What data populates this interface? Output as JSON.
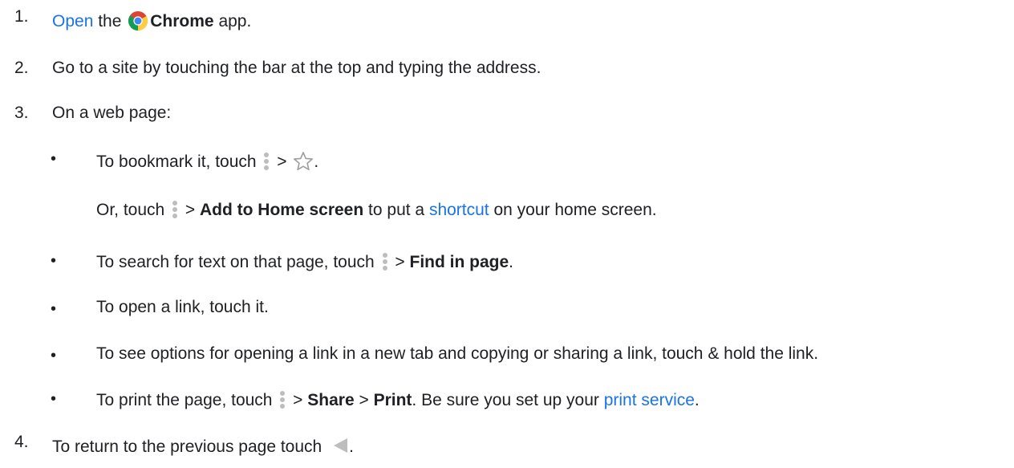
{
  "colors": {
    "link": "#1a73e8",
    "text": "#202124",
    "icon_gray": "#bdbdbd"
  },
  "steps": [
    {
      "number": "1.",
      "parts": {
        "open_link": "Open",
        "the": " the ",
        "app_name": "Chrome",
        "app": " app."
      },
      "icon": "chrome-icon"
    },
    {
      "number": "2.",
      "text": "Go to a site by touching the bar at the top and typing the address."
    },
    {
      "number": "3.",
      "text": "On a web page:",
      "bullets": [
        {
          "bullet": "•",
          "text_before": "To bookmark it, touch ",
          "sep": " > ",
          "end": ".",
          "icons": [
            "more-vert-icon",
            "star-icon"
          ],
          "sub": {
            "text_before": "Or, touch ",
            "sep": " > ",
            "bold": "Add to Home screen",
            "middle": " to put a ",
            "link": "shortcut",
            "end": " on your home screen."
          }
        },
        {
          "bullet": "•",
          "text_before": "To search for text on that page, touch ",
          "sep": " > ",
          "bold": "Find in page",
          "end": "."
        },
        {
          "bullet": "•",
          "text": "To open a link, touch it."
        },
        {
          "bullet": "•",
          "text": "To see options for opening a link in a new tab and copying or sharing a link, touch & hold the link."
        },
        {
          "bullet": "•",
          "text_before": "To print the page, touch ",
          "sep1": " > ",
          "bold1": "Share",
          "sep2": " > ",
          "bold2": "Print",
          "middle": ". Be sure you set up your ",
          "link": "print service",
          "end": "."
        }
      ]
    },
    {
      "number": "4.",
      "text": "To return to the previous page touch ",
      "end": ".",
      "icon": "back-triangle-icon"
    }
  ]
}
